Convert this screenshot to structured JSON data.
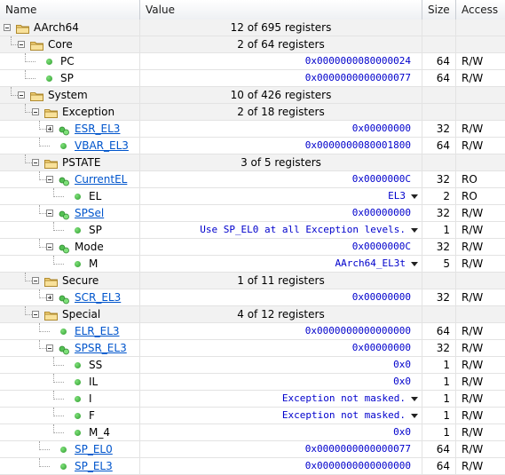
{
  "columns": {
    "name": "Name",
    "value": "Value",
    "size": "Size",
    "access": "Access"
  },
  "rows": [
    {
      "name": "AArch64",
      "count": "12 of 695 registers",
      "kind": "group",
      "icon": "folder-icon",
      "link": false
    },
    {
      "name": "Core",
      "count": "2 of 64 registers",
      "kind": "group",
      "icon": "folder-icon",
      "link": false
    },
    {
      "name": "PC",
      "value": "0x0000000080000024",
      "size": "64",
      "access": "R/W",
      "kind": "reg",
      "icon": "register-dot-icon",
      "link": false
    },
    {
      "name": "SP",
      "value": "0x0000000000000077",
      "size": "64",
      "access": "R/W",
      "kind": "reg",
      "icon": "register-dot-icon",
      "link": false
    },
    {
      "name": "System",
      "count": "10 of 426 registers",
      "kind": "group",
      "icon": "folder-icon",
      "link": false
    },
    {
      "name": "Exception",
      "count": "2 of 18 registers",
      "kind": "group",
      "icon": "folder-icon",
      "link": false
    },
    {
      "name": "ESR_EL3",
      "value": "0x00000000",
      "size": "32",
      "access": "R/W",
      "kind": "reg",
      "icon": "register-dot-icon",
      "link": true
    },
    {
      "name": "VBAR_EL3",
      "value": "0x0000000080001800",
      "size": "64",
      "access": "R/W",
      "kind": "reg",
      "icon": "register-dot-icon",
      "link": true
    },
    {
      "name": "PSTATE",
      "count": "3 of 5 registers",
      "kind": "group",
      "icon": "folder-icon",
      "link": false
    },
    {
      "name": "CurrentEL",
      "value": "0x0000000C",
      "size": "32",
      "access": "RO",
      "kind": "reg",
      "icon": "register-dot-icon",
      "link": true
    },
    {
      "name": "EL",
      "value": "EL3",
      "size": "2",
      "access": "RO",
      "kind": "field",
      "icon": "register-dot-icon",
      "link": false,
      "dropdown": true
    },
    {
      "name": "SPSel",
      "value": "0x00000000",
      "size": "32",
      "access": "R/W",
      "kind": "reg",
      "icon": "register-dot-icon",
      "link": true
    },
    {
      "name": "SP",
      "value": "Use SP_EL0 at all Exception levels.",
      "size": "1",
      "access": "R/W",
      "kind": "field",
      "icon": "register-dot-icon",
      "link": false,
      "dropdown": true
    },
    {
      "name": "Mode",
      "value": "0x0000000C",
      "size": "32",
      "access": "R/W",
      "kind": "reg",
      "icon": "register-dot-icon",
      "link": false
    },
    {
      "name": "M",
      "value": "AArch64_EL3t",
      "size": "5",
      "access": "R/W",
      "kind": "field",
      "icon": "register-dot-icon",
      "link": false,
      "dropdown": true
    },
    {
      "name": "Secure",
      "count": "1 of 11 registers",
      "kind": "group",
      "icon": "folder-icon",
      "link": false
    },
    {
      "name": "SCR_EL3",
      "value": "0x00000000",
      "size": "32",
      "access": "R/W",
      "kind": "reg",
      "icon": "register-dot-icon",
      "link": true
    },
    {
      "name": "Special",
      "count": "4 of 12 registers",
      "kind": "group",
      "icon": "folder-icon",
      "link": false
    },
    {
      "name": "ELR_EL3",
      "value": "0x0000000000000000",
      "size": "64",
      "access": "R/W",
      "kind": "reg",
      "icon": "register-dot-icon",
      "link": true
    },
    {
      "name": "SPSR_EL3",
      "value": "0x00000000",
      "size": "32",
      "access": "R/W",
      "kind": "reg",
      "icon": "register-dot-icon",
      "link": true
    },
    {
      "name": "SS",
      "value": "0x0",
      "size": "1",
      "access": "R/W",
      "kind": "field",
      "icon": "register-dot-icon",
      "link": false
    },
    {
      "name": "IL",
      "value": "0x0",
      "size": "1",
      "access": "R/W",
      "kind": "field",
      "icon": "register-dot-icon",
      "link": false
    },
    {
      "name": "I",
      "value": "Exception not masked.",
      "size": "1",
      "access": "R/W",
      "kind": "field",
      "icon": "register-dot-icon",
      "link": false,
      "dropdown": true
    },
    {
      "name": "F",
      "value": "Exception not masked.",
      "size": "1",
      "access": "R/W",
      "kind": "field",
      "icon": "register-dot-icon",
      "link": false,
      "dropdown": true
    },
    {
      "name": "M_4",
      "value": "0x0",
      "size": "1",
      "access": "R/W",
      "kind": "field",
      "icon": "register-dot-icon",
      "link": false
    },
    {
      "name": "SP_EL0",
      "value": "0x0000000000000077",
      "size": "64",
      "access": "R/W",
      "kind": "reg",
      "icon": "register-dot-icon",
      "link": true
    },
    {
      "name": "SP_EL3",
      "value": "0x0000000000000000",
      "size": "64",
      "access": "R/W",
      "kind": "reg",
      "icon": "register-dot-icon",
      "link": true
    }
  ],
  "colors": {
    "value_text": "#0000cc",
    "link": "#0055cc",
    "group_bg": "#f2f2f2"
  }
}
